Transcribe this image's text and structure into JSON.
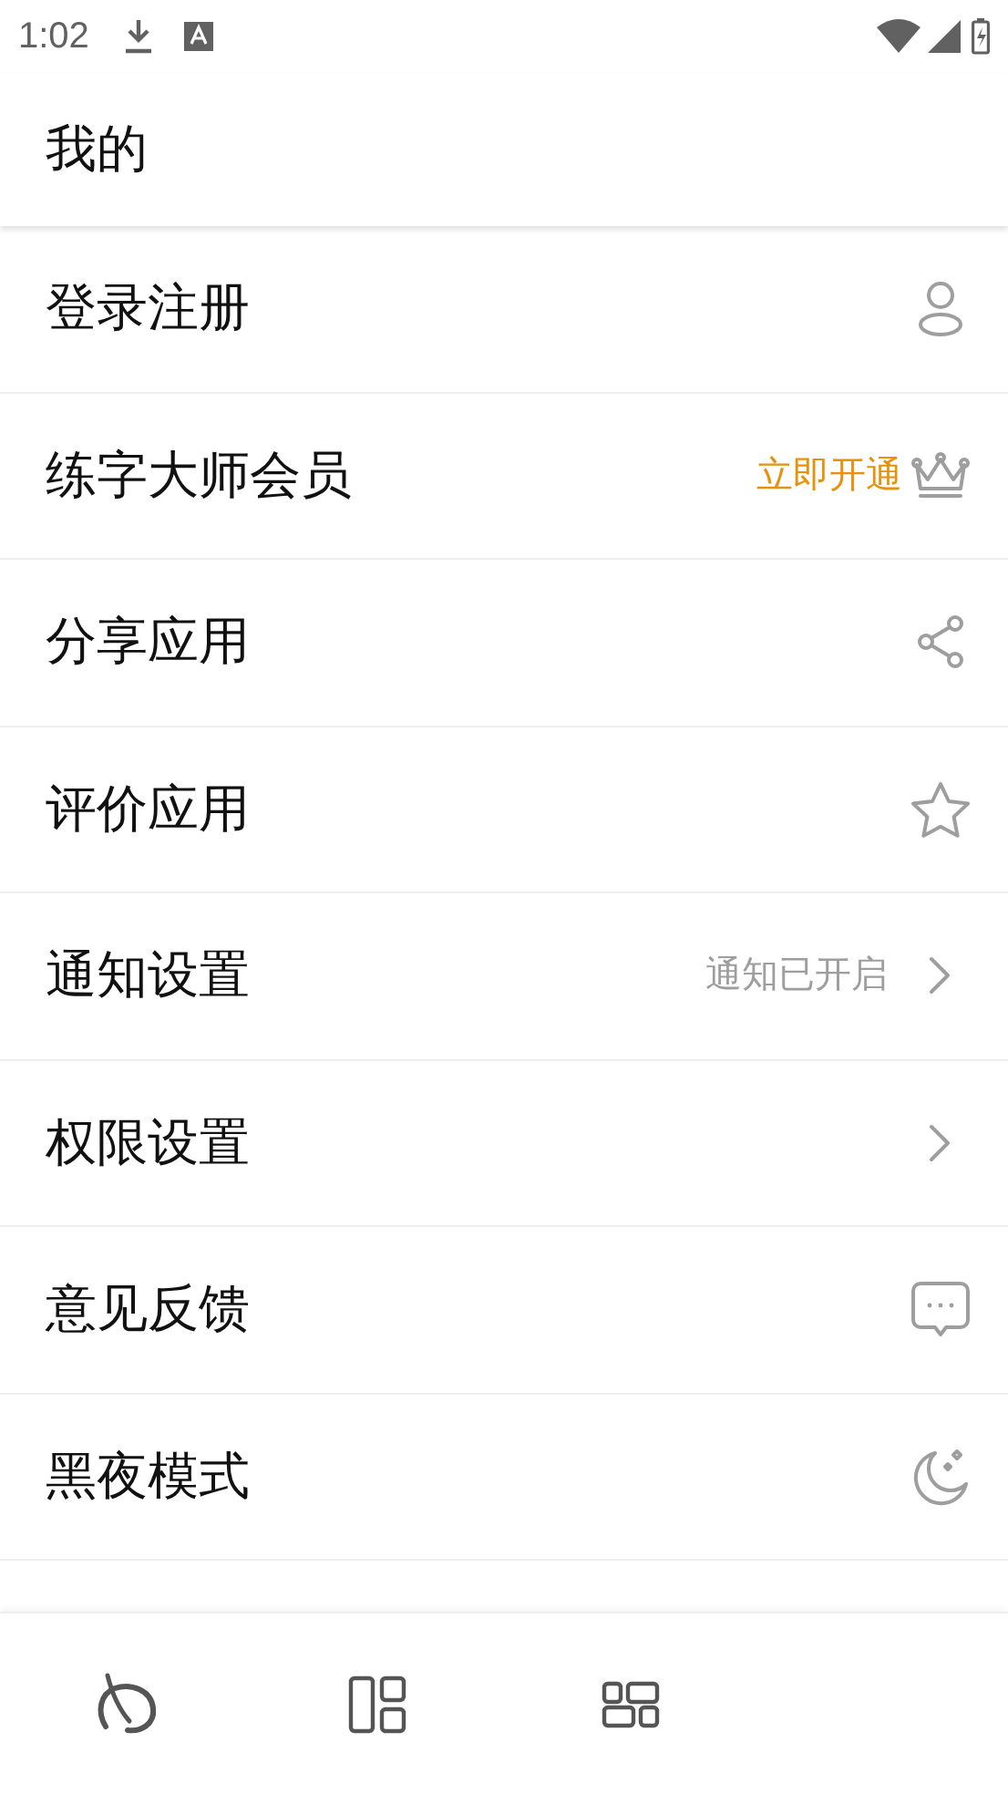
{
  "status_bar": {
    "time": "1:02"
  },
  "header": {
    "title": "我的"
  },
  "menu": [
    {
      "label": "登录注册",
      "kind": "person"
    },
    {
      "label": "练字大师会员",
      "note": {
        "text": "立即开通",
        "highlight": true
      },
      "kind": "crown"
    },
    {
      "label": "分享应用",
      "kind": "share"
    },
    {
      "label": "评价应用",
      "kind": "star"
    },
    {
      "label": "通知设置",
      "note": {
        "text": "通知已开启",
        "highlight": false
      },
      "kind": "chevron"
    },
    {
      "label": "权限设置",
      "kind": "chevron"
    },
    {
      "label": "意见反馈",
      "kind": "chat"
    },
    {
      "label": "黑夜模式",
      "kind": "moon"
    }
  ],
  "bottom_nav": [
    {
      "kind": "brush"
    },
    {
      "kind": "layout"
    },
    {
      "kind": "grid"
    }
  ]
}
